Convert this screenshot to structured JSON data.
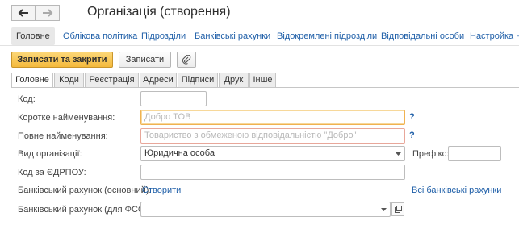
{
  "window": {
    "title": "Організація (створення)"
  },
  "nav": {
    "tabs": [
      {
        "label": "Головне"
      },
      {
        "label": "Облікова політика"
      },
      {
        "label": "Підрозділи"
      },
      {
        "label": "Банківські рахунки"
      },
      {
        "label": "Відокремлені підрозділи"
      },
      {
        "label": "Відповідальні особи"
      },
      {
        "label": "Настройка ну"
      }
    ]
  },
  "toolbar": {
    "save_close_label": "Записати та закрити",
    "save_label": "Записати",
    "attach_icon": "paperclip-icon"
  },
  "form_tabs": [
    {
      "label": "Головне"
    },
    {
      "label": "Коди"
    },
    {
      "label": "Реєстрація"
    },
    {
      "label": "Адреси"
    },
    {
      "label": "Підписи"
    },
    {
      "label": "Друк"
    },
    {
      "label": "Інше"
    }
  ],
  "form": {
    "code": {
      "label": "Код:",
      "value": ""
    },
    "short_name": {
      "label": "Коротке найменування:",
      "placeholder": "Добро ТОВ",
      "help": "?"
    },
    "full_name": {
      "label": "Повне найменування:",
      "placeholder": "Товариство з обмеженою відповідальністю \"Добро\"",
      "help": "?"
    },
    "org_type": {
      "label": "Вид організації:",
      "value": "Юридична особа"
    },
    "prefix": {
      "label": "Префікс:",
      "value": ""
    },
    "edrpou": {
      "label": "Код за ЄДРПОУ:",
      "value": ""
    },
    "bank_main": {
      "label": "Банківський рахунок (основний):",
      "create_link": "Створити",
      "all_link": "Всі банківські рахунки"
    },
    "bank_fss": {
      "label": "Банківський рахунок (для ФСС):",
      "value": ""
    }
  },
  "colors": {
    "accent": "#f4b93c",
    "link": "#1f5fa8",
    "required_border": "#e8a79a"
  }
}
